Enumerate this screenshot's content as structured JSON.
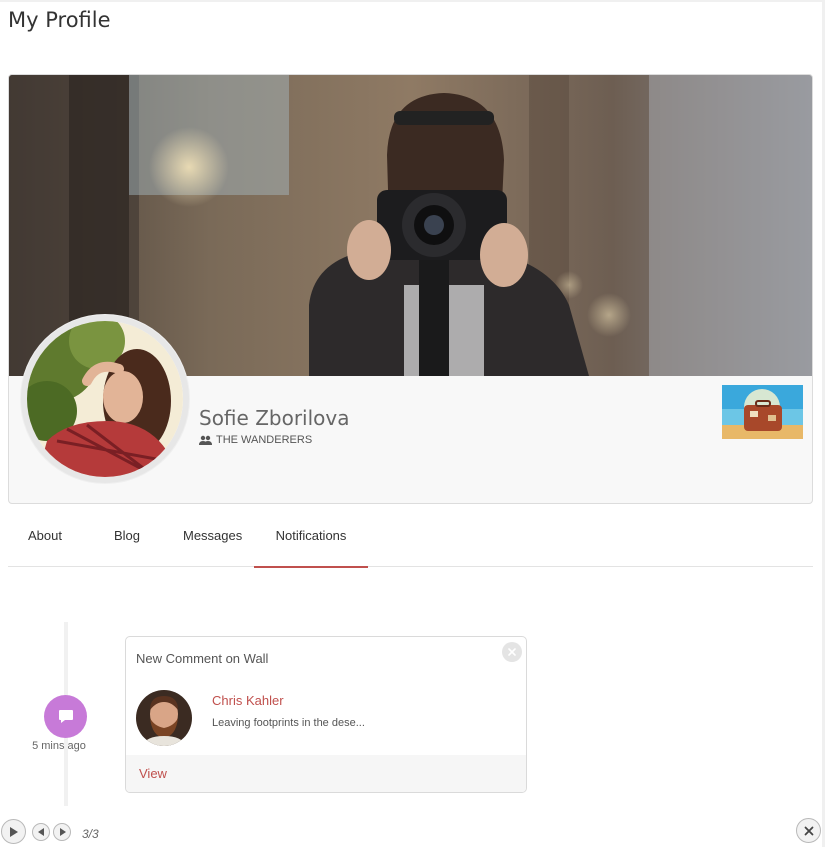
{
  "page": {
    "title": "My Profile"
  },
  "profile": {
    "name": "Sofie Zborilova",
    "group": "THE WANDERERS"
  },
  "tabs": [
    {
      "label": "About",
      "active": false
    },
    {
      "label": "Blog",
      "active": false
    },
    {
      "label": "Messages",
      "active": false
    },
    {
      "label": "Notifications",
      "active": true
    }
  ],
  "notification": {
    "time": "5 mins ago",
    "heading": "New Comment on Wall",
    "commenter": "Chris Kahler",
    "comment": "Leaving footprints in the dese...",
    "action": "View"
  },
  "player": {
    "counter": "3/3"
  },
  "icons": {
    "notif_bubble": "comment-icon",
    "group": "users-icon",
    "close": "close-icon"
  },
  "colors": {
    "accent": "#c0504d",
    "notif_bubble": "#c77ad8"
  }
}
